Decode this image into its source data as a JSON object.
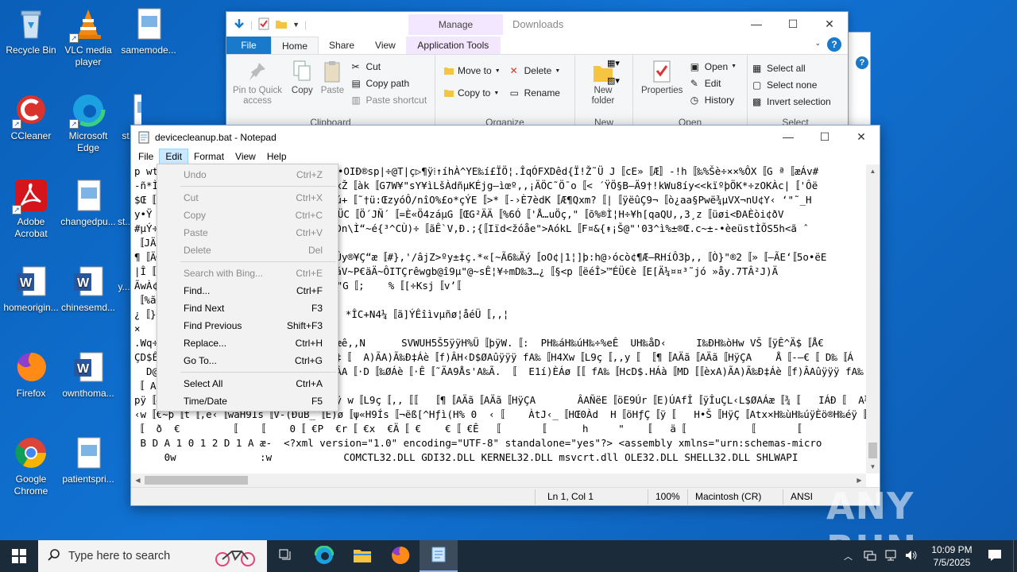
{
  "desktop": {
    "icons": [
      {
        "label": "Recycle Bin"
      },
      {
        "label": "VLC media player"
      },
      {
        "label": "samemode..."
      },
      {
        "label": "CCleaner"
      },
      {
        "label": "Microsoft Edge"
      },
      {
        "label": "st..."
      },
      {
        "label": "Adobe Acrobat"
      },
      {
        "label": "changedpu..."
      },
      {
        "label": "st..."
      },
      {
        "label": "homeorigin..."
      },
      {
        "label": "chinesemd..."
      },
      {
        "label": "y..."
      },
      {
        "label": "Firefox"
      },
      {
        "label": "ownthoma..."
      },
      {
        "label": "Google Chrome"
      },
      {
        "label": "patientspri..."
      }
    ]
  },
  "explorer": {
    "title": "Downloads",
    "manage_label": "Manage",
    "tabs": [
      "File",
      "Home",
      "Share",
      "View",
      "Application Tools"
    ],
    "clipboard": {
      "pin": "Pin to Quick access",
      "copy": "Copy",
      "paste": "Paste",
      "cut": "Cut",
      "copy_path": "Copy path",
      "paste_shortcut": "Paste shortcut",
      "label": "Clipboard"
    },
    "organize": {
      "move_to": "Move to",
      "copy_to": "Copy to",
      "delete": "Delete",
      "rename": "Rename",
      "label": "Organize"
    },
    "new": {
      "new_folder": "New folder",
      "label": "New"
    },
    "open": {
      "properties": "Properties",
      "open": "Open",
      "edit": "Edit",
      "history": "History",
      "label": "Open"
    },
    "select": {
      "select_all": "Select all",
      "select_none": "Select none",
      "invert": "Invert selection",
      "label": "Select"
    }
  },
  "notepad": {
    "title": "devicecleanup.bat - Notepad",
    "menu": [
      "File",
      "Edit",
      "Format",
      "View",
      "Help"
    ],
    "lines": [
      "p wt                     ÑY}.öÝ÷˜˜•OIÐ®sp|÷@T|ç▷¶ÿ⁞↑íhÀ^YE‰í£ÏÖ¦.ÎqÓFXDêd{Ï!Ž˜Ü J〚cE»〚Æ〛-!h〚‰%Šè÷××%ÔX〚G ª〚æÁv#",
      "-ñ*Ì                     ÙyZ〚˜,ó}xŽ〚àk〚G7W¥\"sY¥ìLšÀdñµKÉjg–ìœº,,¡ÄÖC˜Ö¯o〚< ´ŸÖ§B–Ä9†!kWu8íy<<kïºþÖK*÷zOKÀc|〚'Ôë",
      "$Œ〚ä                     ÄüqUEg¹åú+〚˜†ü:ŒzyóÔ/nîO%£o*çÝE〚>*〚-›È7èdK〚Æ¶Qxm?〚|〚ÿëûÇ9¬〚ò¿aa§Pwë¾µVX¬nU¢Y‹ ‘\"˜_H",
      "y•Ÿ                      ÏÇã_8æ•<¼ÜC〚Ö´JÑ´〚=È«Ö4záµG〚ŒG²ÄÄ〚%6Ó〚'Å…uÖç,\"〚õ%®Ì¦H÷¥h[qaQU,,3¸z〚üøi<ÐAÈòi¢ðV",
      "#µÝ÷                     ´Ÿ〚▷e   Ðn\\Ì“~é{³^CÙ)÷〚ãÊ`V,Ð.;{〚Iïd<žóåe\">AókL〚F¤&{↟¡Š@\"'03^ì%±®Œ.c~±-•èeüstÌÕS5h<ã ˆ",
      "〚JÄ¡",
      "¶〚Ä©                     +\"ÙB–MÌmÛy®¥Ç“æ〚#},'/âjZ>ºy±‡ç.*«[~Ã6‰Äý〚oO¢|1¦]þ:h@›ócò¢¶Æ–RHíÔ3þ,,〚Ò}\"®2〚»〚–ÃE‘〚5o•ëE",
      "|Î〚P                        >—+Ä6áV~P€äÄ~ÔITÇrêwgb@î9µ\"@~sÊ¦¥÷mD‰3…¿〚§<p〚ëéÎ>™ÉÜ€è〚E[Ä¼¤¤³˜jó »åy.7TÂ²J)Ä",
      "ÃwÀ¢                     ‘\\-#IÀþ[〚\"G〚;    %〚[÷Ksj〚v’〚",
      "〚%ã€",
      "¿〚}€                     .Ÿ〚žKzy¹ *ÎC+N4¼〚ã]ÝÊîìvµñø¦åéÜ〚,,¦",
      "×",
      ".Wq÷                     g/&‹ç^〚!æê,,N      SVWUH5Š5ÿÿH%Ü〚þÿW.〚:  PH‰áH‰úH‰÷%eÊ  UH‰åD‹     I‰ÐH‰òHw VŠ〚ÿÊ^Ä$〚Å€",
      "ÇD$Ê                     〚ÐÐ‰T$È€‡〚  A)ÃA)Ã‰Ð‡Áè〚f)ÂH‹D$ØAûÿÿÿ fA‰〚H4Xw〚L9ç〚,,y〚 〚¶〚AÄã〚AÄã〚HÿÇA    Å〚-–€〚 D‰〚Á",
      "  D@                     〚HÿÇA   ÂA〚·D〚‰ØÁè〚·Ê〚˜ÄA9Ås'A‰Ã. 〚  E1í)ÈÁø〚〚 fA‰〚HcD$.HÁà〚MD〚〚èxA)ÃA)Ã‰Ð‡Áè〚f)ÂAûÿÿÿ fA‰",
      "〚 A",
      "pÿ〚#                     ëQpûAûÿÿÿ w〚L9ç〚,,〚〚  〚¶〚AÄã〚AÄã〚HÿÇA       ÂAÑëE〚öE9Úr〚E)ÚAfÎ〚ÿÎuÇL‹L$ØAÁæ〚¾〚   IÁÐ〚  A½〚",
      "‹w〚€~þ〚t〚,e‹〚waH9Ís〚V-(ÐuB_〚E)ø〚ψ«H9Ís〚¬ëß[^Hƒì(H% 0  ‹〚    ÀtJ‹_〚HŒ0Àd  H〚öHƒÇ〚ÿ〚   H•Š〚HÿÇ〚Atx×H‰ùH‰úÿÈö®H‰éÿ〚〚  H     Àt",
      "〚  ð  €        〚   〚    0〚 €P  €r〚 €x  €Ä〚 €    €〚 €Ê  〚      〚      h     \"   〚   ä〚          〚      〚",
      " B D A 1 0 1 2 D 1 A æ-  <?xml version=\"1.0\" encoding=\"UTF-8\" standalone=\"yes\"?> <assembly xmlns=\"urn:schemas-micro",
      "     0w              :w            COMCTL32.DLL GDI32.DLL KERNEL32.DLL msvcrt.dll OLE32.DLL SHELL32.DLL SHLWAPI"
    ],
    "status": {
      "position": "Ln 1, Col 1",
      "zoom": "100%",
      "eol": "Macintosh (CR)",
      "encoding": "ANSI"
    }
  },
  "edit_menu": {
    "items": [
      {
        "label": "Undo",
        "shortcut": "Ctrl+Z",
        "enabled": false
      },
      {
        "label": "Cut",
        "shortcut": "Ctrl+X",
        "enabled": false
      },
      {
        "label": "Copy",
        "shortcut": "Ctrl+C",
        "enabled": false
      },
      {
        "label": "Paste",
        "shortcut": "Ctrl+V",
        "enabled": false
      },
      {
        "label": "Delete",
        "shortcut": "Del",
        "enabled": false
      },
      {
        "label": "Search with Bing...",
        "shortcut": "Ctrl+E",
        "enabled": false
      },
      {
        "label": "Find...",
        "shortcut": "Ctrl+F",
        "enabled": true
      },
      {
        "label": "Find Next",
        "shortcut": "F3",
        "enabled": true
      },
      {
        "label": "Find Previous",
        "shortcut": "Shift+F3",
        "enabled": true
      },
      {
        "label": "Replace...",
        "shortcut": "Ctrl+H",
        "enabled": true
      },
      {
        "label": "Go To...",
        "shortcut": "Ctrl+G",
        "enabled": true
      },
      {
        "label": "Select All",
        "shortcut": "Ctrl+A",
        "enabled": true
      },
      {
        "label": "Time/Date",
        "shortcut": "F5",
        "enabled": true
      }
    ]
  },
  "taskbar": {
    "search_placeholder": "Type here to search",
    "time": "10:09 PM",
    "date": "7/5/2025"
  },
  "watermark": "ANY RUN"
}
